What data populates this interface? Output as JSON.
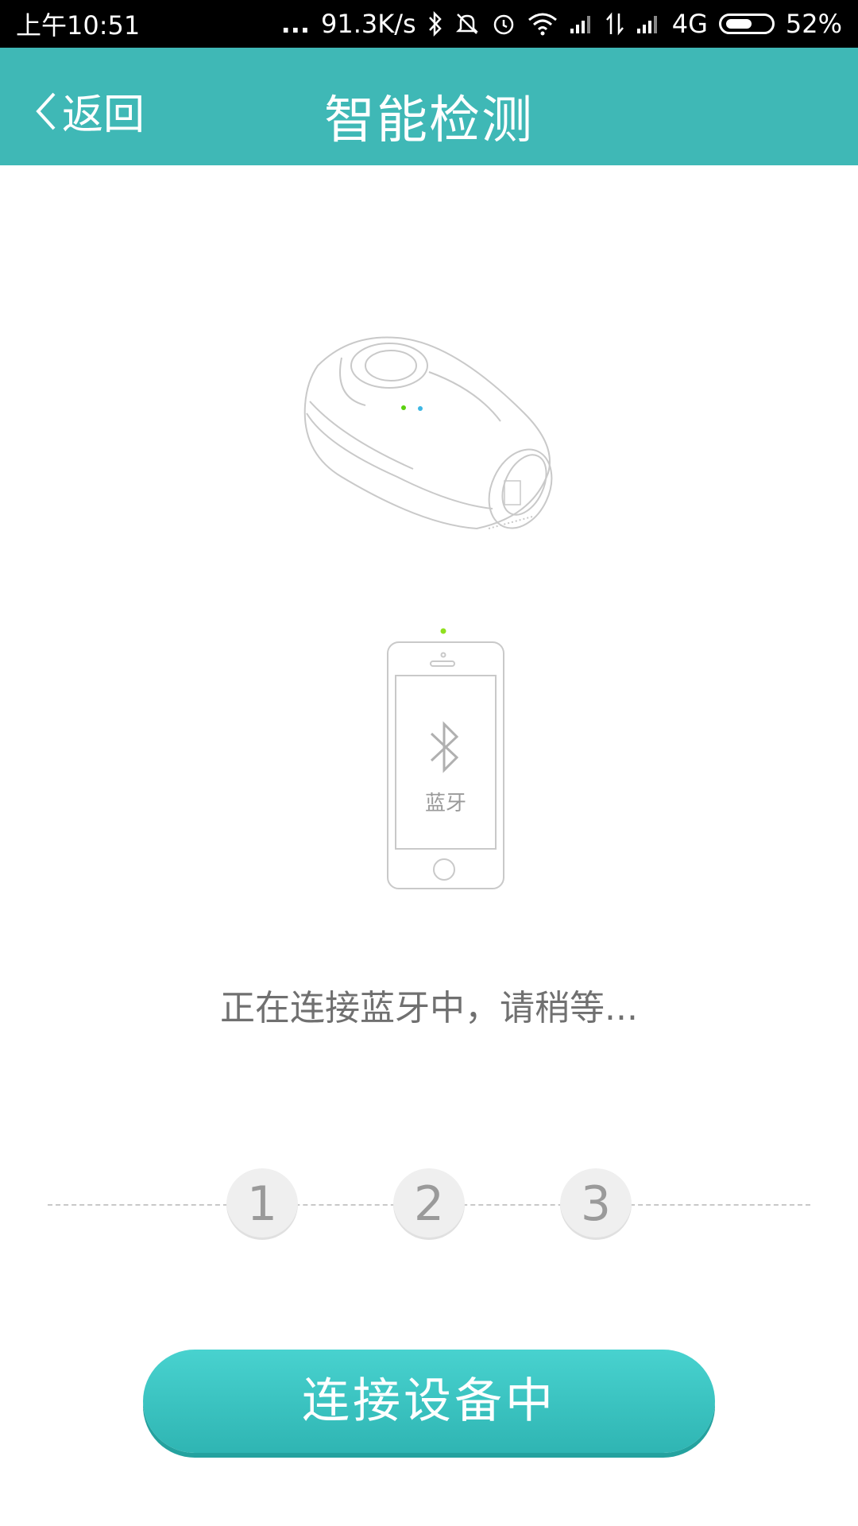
{
  "status_bar": {
    "time": "上午10:51",
    "dots": "...",
    "speed": "91.3K/s",
    "network": "4G",
    "battery": "52%"
  },
  "header": {
    "back_label": "返回",
    "title": "智能检测"
  },
  "phone_screen": {
    "bluetooth_label": "蓝牙"
  },
  "status_message": "正在连接蓝牙中，请稍等...",
  "steps": [
    "1",
    "2",
    "3"
  ],
  "button": {
    "label": "连接设备中"
  },
  "colors": {
    "header_bg": "#3fb8b6",
    "button": "#3cc6c3",
    "led_green": "#5bd10f",
    "led_blue": "#3db7e4"
  }
}
